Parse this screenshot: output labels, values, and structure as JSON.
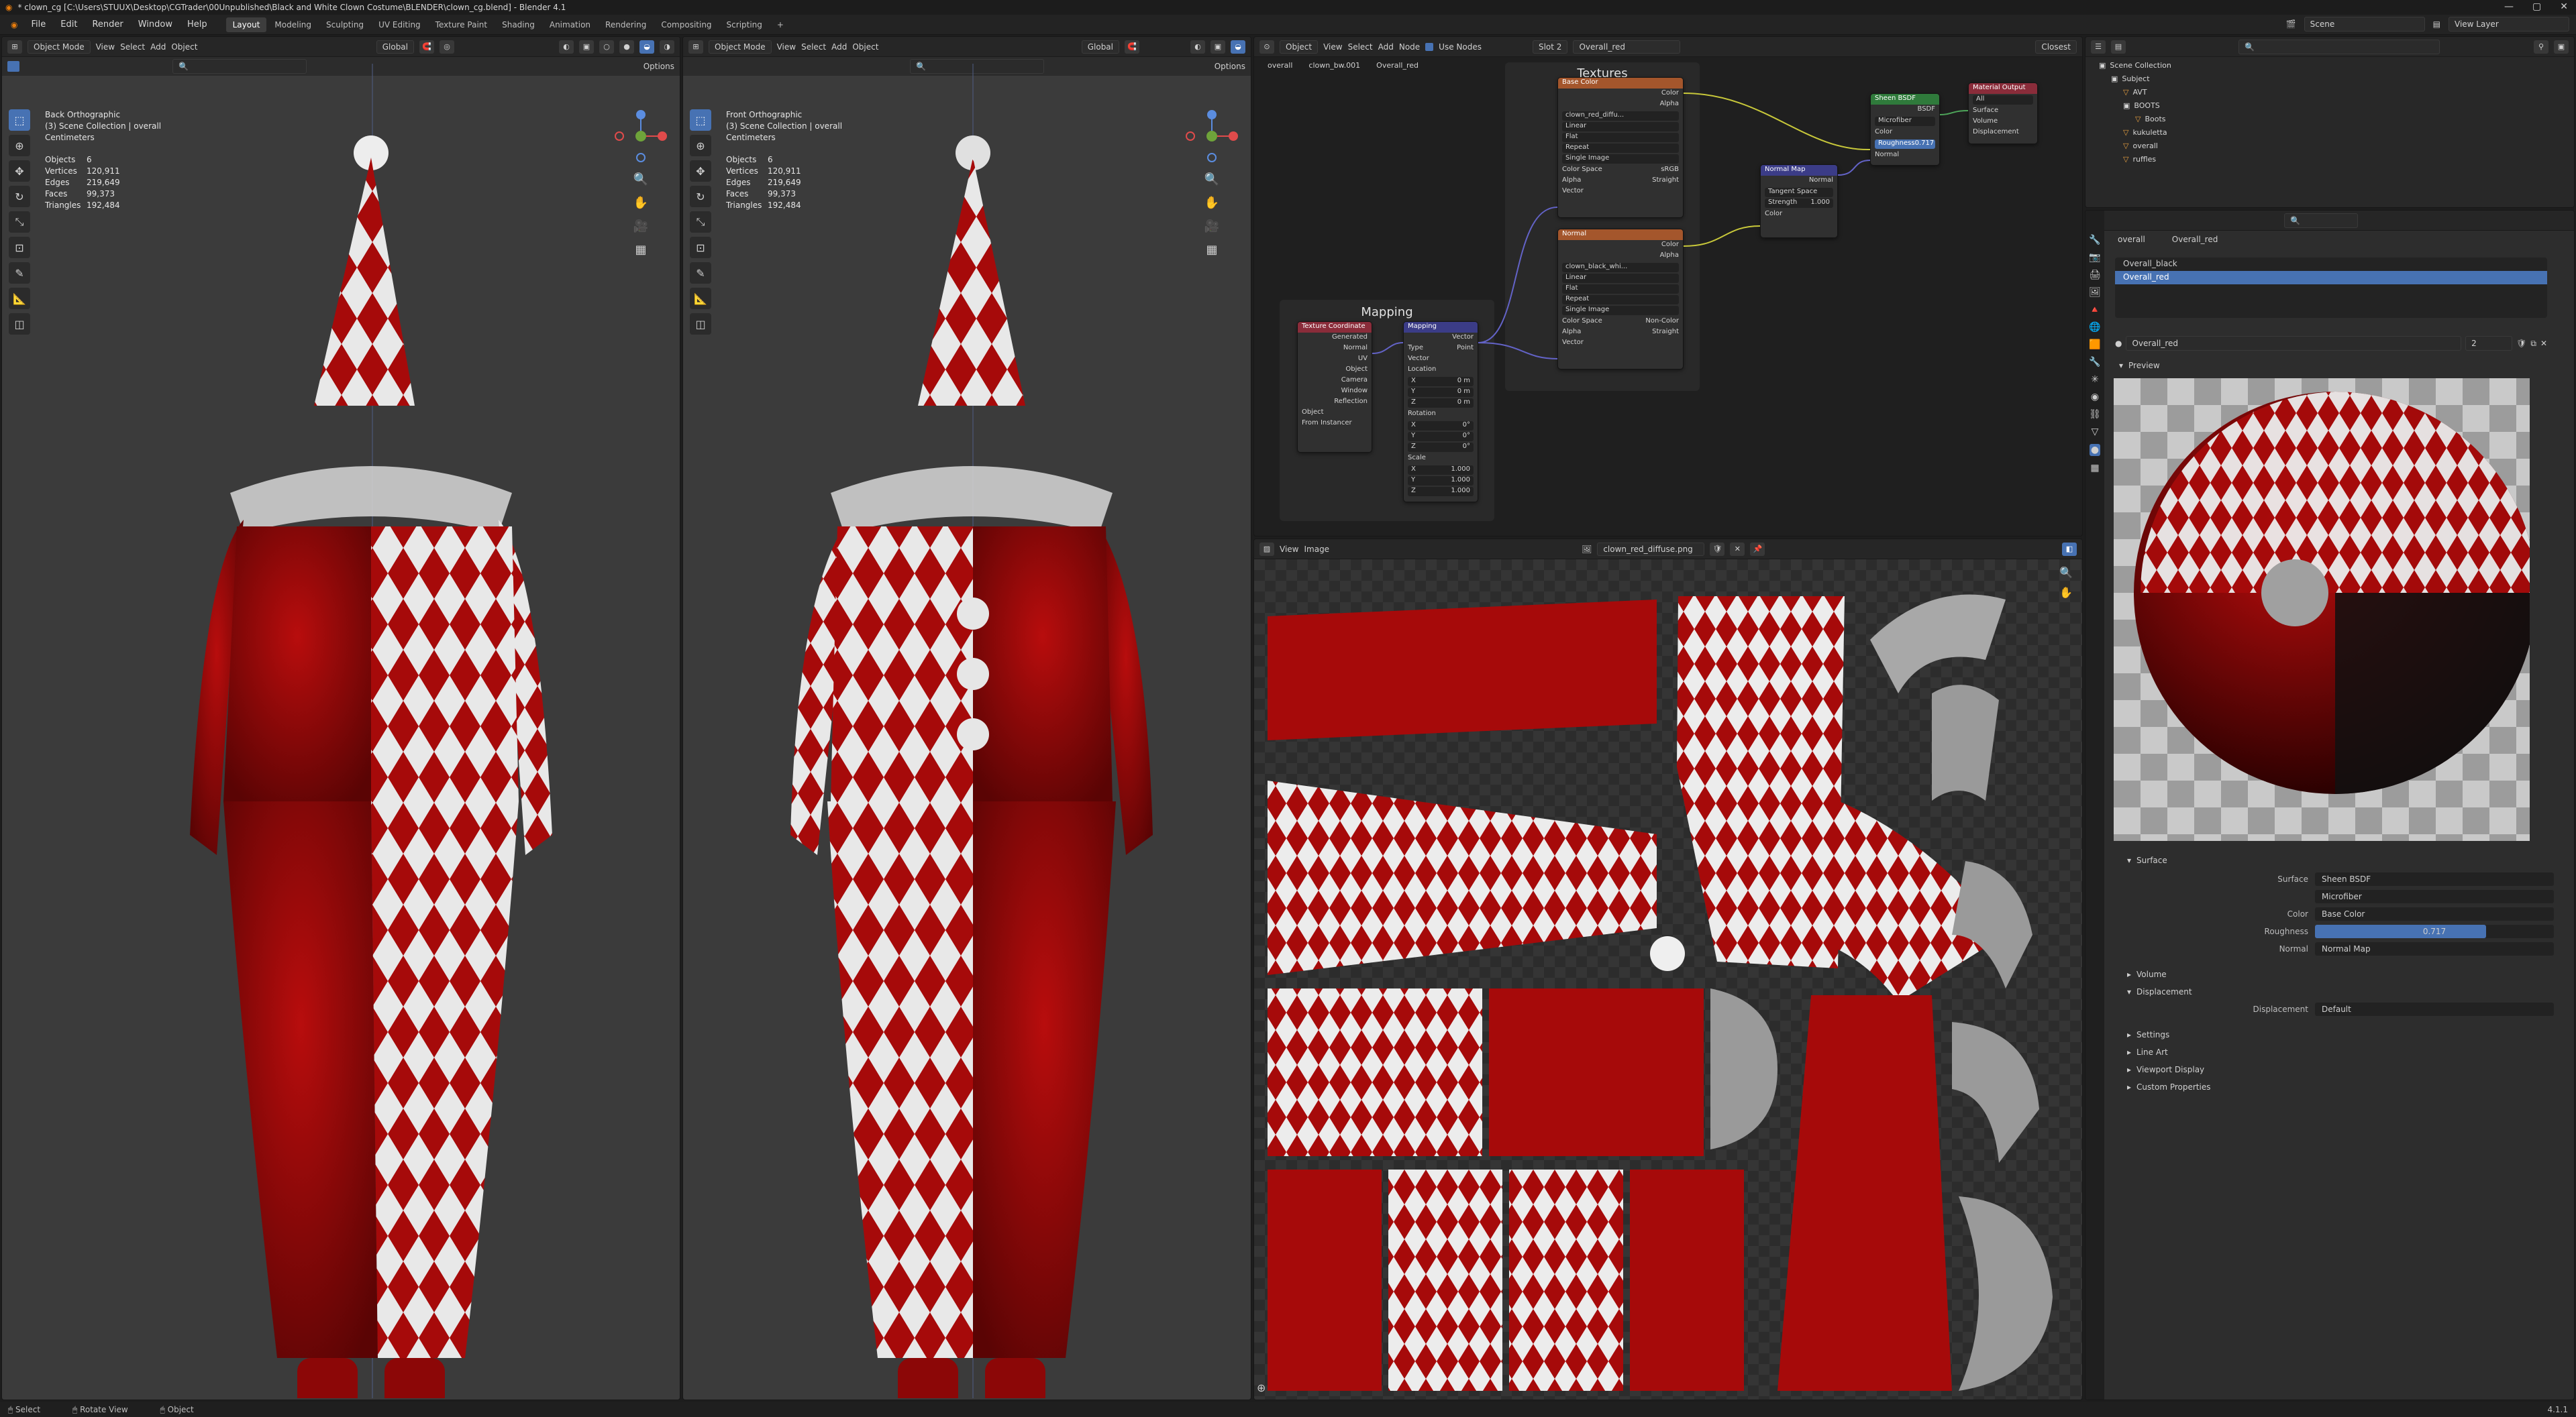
{
  "titlebar": {
    "title": "* clown_cg [C:\\Users\\STUUX\\Desktop\\CGTrader\\00Unpublished\\Black and White Clown Costume\\BLENDER\\clown_cg.blend] - Blender 4.1"
  },
  "menu": {
    "items": [
      "File",
      "Edit",
      "Render",
      "Window",
      "Help"
    ],
    "workspaces": [
      "Layout",
      "Modeling",
      "Sculpting",
      "UV Editing",
      "Texture Paint",
      "Shading",
      "Animation",
      "Rendering",
      "Compositing",
      "Scripting"
    ],
    "active_workspace": "Layout",
    "scene": "Scene",
    "view_layer": "View Layer"
  },
  "viewport_left": {
    "mode": "Object Mode",
    "menus": [
      "View",
      "Select",
      "Add",
      "Object"
    ],
    "orientation": "Global",
    "options": "Options",
    "view_name": "Back Orthographic",
    "collection": "(3) Scene Collection | overall",
    "units": "Centimeters",
    "stats": [
      {
        "k": "Objects",
        "v": "6"
      },
      {
        "k": "Vertices",
        "v": "120,911"
      },
      {
        "k": "Edges",
        "v": "219,649"
      },
      {
        "k": "Faces",
        "v": "99,373"
      },
      {
        "k": "Triangles",
        "v": "192,484"
      }
    ]
  },
  "viewport_right": {
    "mode": "Object Mode",
    "menus": [
      "View",
      "Select",
      "Add",
      "Object"
    ],
    "orientation": "Global",
    "options": "Options",
    "view_name": "Front Orthographic",
    "collection": "(3) Scene Collection | overall",
    "units": "Centimeters",
    "stats": [
      {
        "k": "Objects",
        "v": "6"
      },
      {
        "k": "Vertices",
        "v": "120,911"
      },
      {
        "k": "Edges",
        "v": "219,649"
      },
      {
        "k": "Faces",
        "v": "99,373"
      },
      {
        "k": "Triangles",
        "v": "192,484"
      }
    ]
  },
  "node_editor": {
    "object_mode": "Object",
    "menus": [
      "View",
      "Select",
      "Add",
      "Node"
    ],
    "use_nodes": "Use Nodes",
    "slot": "Slot 2",
    "material": "Overall_red",
    "breadcrumb": [
      "overall",
      "clown_bw.001",
      "Overall_red"
    ],
    "frame_textures": "Textures",
    "frame_mapping": "Mapping",
    "closest": "Closest",
    "nodes": {
      "base_color": {
        "title": "Base Color",
        "image": "clown_red_diffu...",
        "interp": "Linear",
        "proj": "Flat",
        "ext": "Repeat",
        "src": "Single Image",
        "cs_label": "Color Space",
        "cs": "sRGB",
        "alpha_label": "Alpha",
        "alpha": "Straight",
        "out1": "Color",
        "out2": "Alpha",
        "in": "Vector"
      },
      "normal": {
        "title": "Normal",
        "image": "clown_black_whi...",
        "interp": "Linear",
        "proj": "Flat",
        "ext": "Repeat",
        "src": "Single Image",
        "cs_label": "Color Space",
        "cs": "Non-Color",
        "alpha_label": "Alpha",
        "alpha": "Straight",
        "out1": "Color",
        "out2": "Alpha",
        "in": "Vector"
      },
      "tex_coord": {
        "title": "Texture Coordinate",
        "outs": [
          "Generated",
          "Normal",
          "UV",
          "Object",
          "Camera",
          "Window",
          "Reflection"
        ],
        "object_label": "Object",
        "from_instancer": "From Instancer"
      },
      "mapping": {
        "title": "Mapping",
        "out": "Vector",
        "type_label": "Type",
        "type": "Point",
        "in": "Vector",
        "loc": "Location",
        "rot": "Rotation",
        "scale": "Scale",
        "loc_vals": [
          {
            "a": "X",
            "v": "0 m"
          },
          {
            "a": "Y",
            "v": "0 m"
          },
          {
            "a": "Z",
            "v": "0 m"
          }
        ],
        "rot_vals": [
          {
            "a": "X",
            "v": "0°"
          },
          {
            "a": "Y",
            "v": "0°"
          },
          {
            "a": "Z",
            "v": "0°"
          }
        ],
        "scale_vals": [
          {
            "a": "X",
            "v": "1.000"
          },
          {
            "a": "Y",
            "v": "1.000"
          },
          {
            "a": "Z",
            "v": "1.000"
          }
        ]
      },
      "normal_map": {
        "title": "Normal Map",
        "out": "Normal",
        "space": "Tangent Space",
        "strength_label": "Strength",
        "strength": "1.000",
        "in": "Color"
      },
      "sheen": {
        "title": "Sheen BSDF",
        "out": "BSDF",
        "dist": "Microfiber",
        "in1": "Color",
        "rough_label": "Roughness",
        "rough": "0.717",
        "in3": "Normal"
      },
      "output": {
        "title": "Material Output",
        "target": "All",
        "ins": [
          "Surface",
          "Volume",
          "Displacement"
        ]
      }
    }
  },
  "image_editor": {
    "menus": [
      "View",
      "Image"
    ],
    "image_name": "clown_red_diffuse.png"
  },
  "outliner": {
    "search_placeholder": "",
    "rows": [
      {
        "label": "Scene Collection",
        "indent": 0
      },
      {
        "label": "Subject",
        "indent": 1
      },
      {
        "label": "AVT",
        "indent": 2
      },
      {
        "label": "BOOTS",
        "indent": 2
      },
      {
        "label": "Boots",
        "indent": 3
      },
      {
        "label": "kukuletta",
        "indent": 2
      },
      {
        "label": "overall",
        "indent": 2
      },
      {
        "label": "ruffles",
        "indent": 2
      }
    ]
  },
  "properties": {
    "breadcrumb": [
      "overall",
      "Overall_red"
    ],
    "slots": [
      "Overall_black",
      "Overall_red"
    ],
    "active_slot": "Overall_red",
    "material_name": "Overall_red",
    "users": "2",
    "preview_label": "Preview",
    "surface_panel": "Surface",
    "rows": [
      {
        "label": "Surface",
        "value": "Sheen BSDF"
      },
      {
        "label": "",
        "value": "Microfiber"
      },
      {
        "label": "Color",
        "value": "Base Color"
      },
      {
        "label": "Roughness",
        "value": "0.717"
      },
      {
        "label": "Normal",
        "value": "Normal Map"
      }
    ],
    "volume": "Volume",
    "displacement_panel": "Displacement",
    "displacement_label": "Displacement",
    "displacement_value": "Default",
    "settings": "Settings",
    "line_art": "Line Art",
    "viewport_display": "Viewport Display",
    "custom_properties": "Custom Properties",
    "roughness_fraction": 0.717
  },
  "statusbar": {
    "items": [
      "Select",
      "Rotate View",
      "Object"
    ],
    "version": "4.1.1"
  },
  "colors": {
    "accent": "#4772b3",
    "red": "#a60a0a",
    "white": "#e8e8e8",
    "viewport_bg": "#3b3b3b"
  }
}
